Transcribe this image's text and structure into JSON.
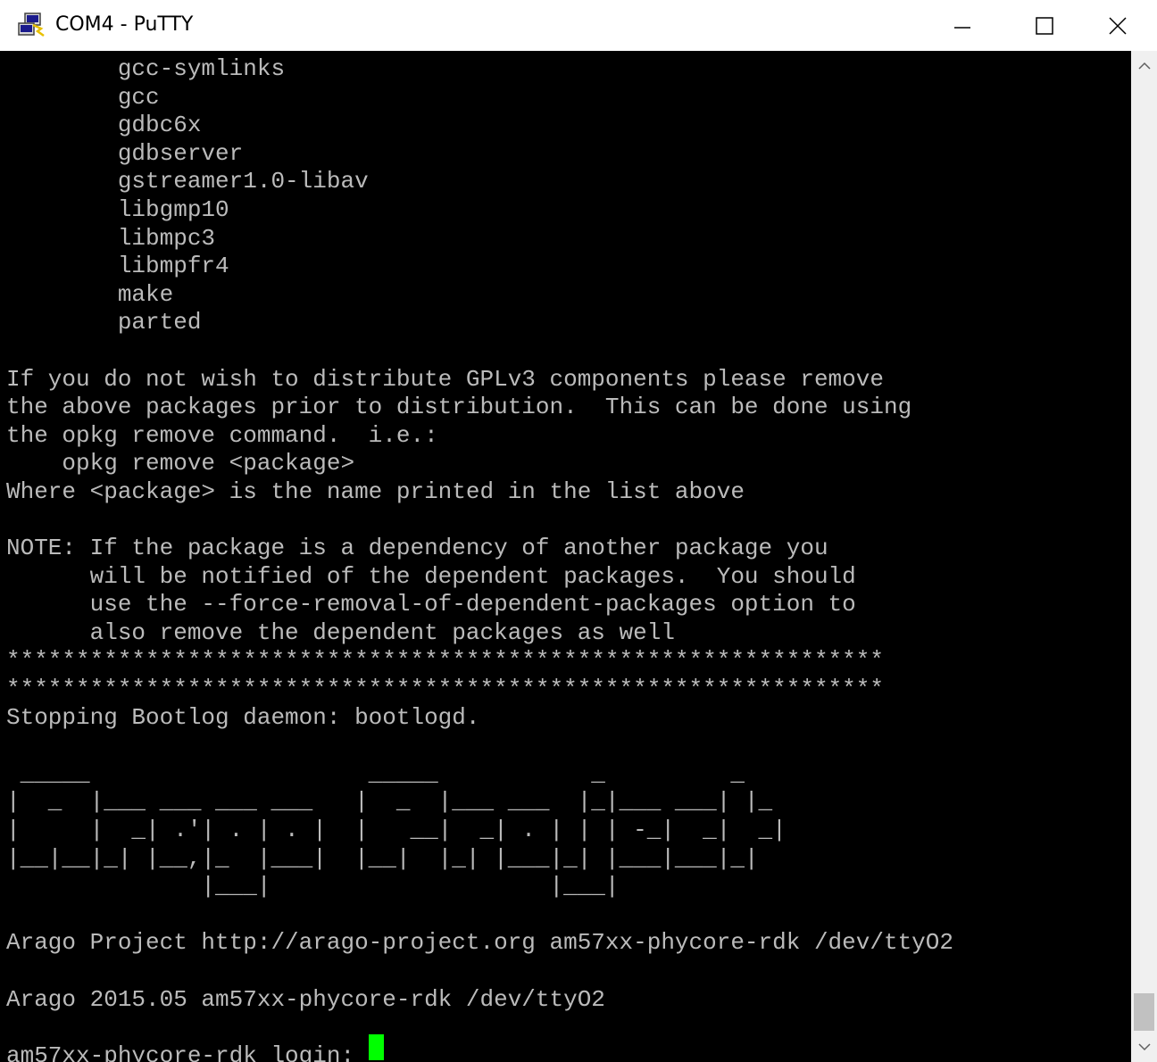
{
  "window": {
    "title": "COM4 - PuTTY",
    "icons": {
      "app": "putty-icon",
      "minimize": "minimize-icon",
      "maximize": "maximize-icon",
      "close": "close-icon"
    }
  },
  "terminal": {
    "background": "#000000",
    "foreground": "#bbbbbb",
    "cursor_color": "#00ff00",
    "lines": [
      "        gcc-symlinks",
      "        gcc",
      "        gdbc6x",
      "        gdbserver",
      "        gstreamer1.0-libav",
      "        libgmp10",
      "        libmpc3",
      "        libmpfr4",
      "        make",
      "        parted",
      "",
      "If you do not wish to distribute GPLv3 components please remove",
      "the above packages prior to distribution.  This can be done using",
      "the opkg remove command.  i.e.:",
      "    opkg remove <package>",
      "Where <package> is the name printed in the list above",
      "",
      "NOTE: If the package is a dependency of another package you",
      "      will be notified of the dependent packages.  You should",
      "      use the --force-removal-of-dependent-packages option to",
      "      also remove the dependent packages as well",
      "***************************************************************",
      "***************************************************************",
      "Stopping Bootlog daemon: bootlogd.",
      "",
      " _____                    _____           _         _",
      "|  _  |___ ___ ___ ___   |  _  |___ ___  |_|___ ___| |_",
      "|     |  _| .'| . | . |  |   __|  _| . | | | -_|  _|  _|",
      "|__|__|_| |__,|_  |___|  |__|  |_| |___|_| |___|___|_|",
      "              |___|                    |___|",
      "",
      "Arago Project http://arago-project.org am57xx-phycore-rdk /dev/ttyO2",
      "",
      "Arago 2015.05 am57xx-phycore-rdk /dev/ttyO2",
      "",
      "am57xx-phycore-rdk login: "
    ]
  },
  "scrollbar": {
    "up_icon": "chevron-up-icon",
    "down_icon": "chevron-down-icon",
    "position": "bottom"
  }
}
